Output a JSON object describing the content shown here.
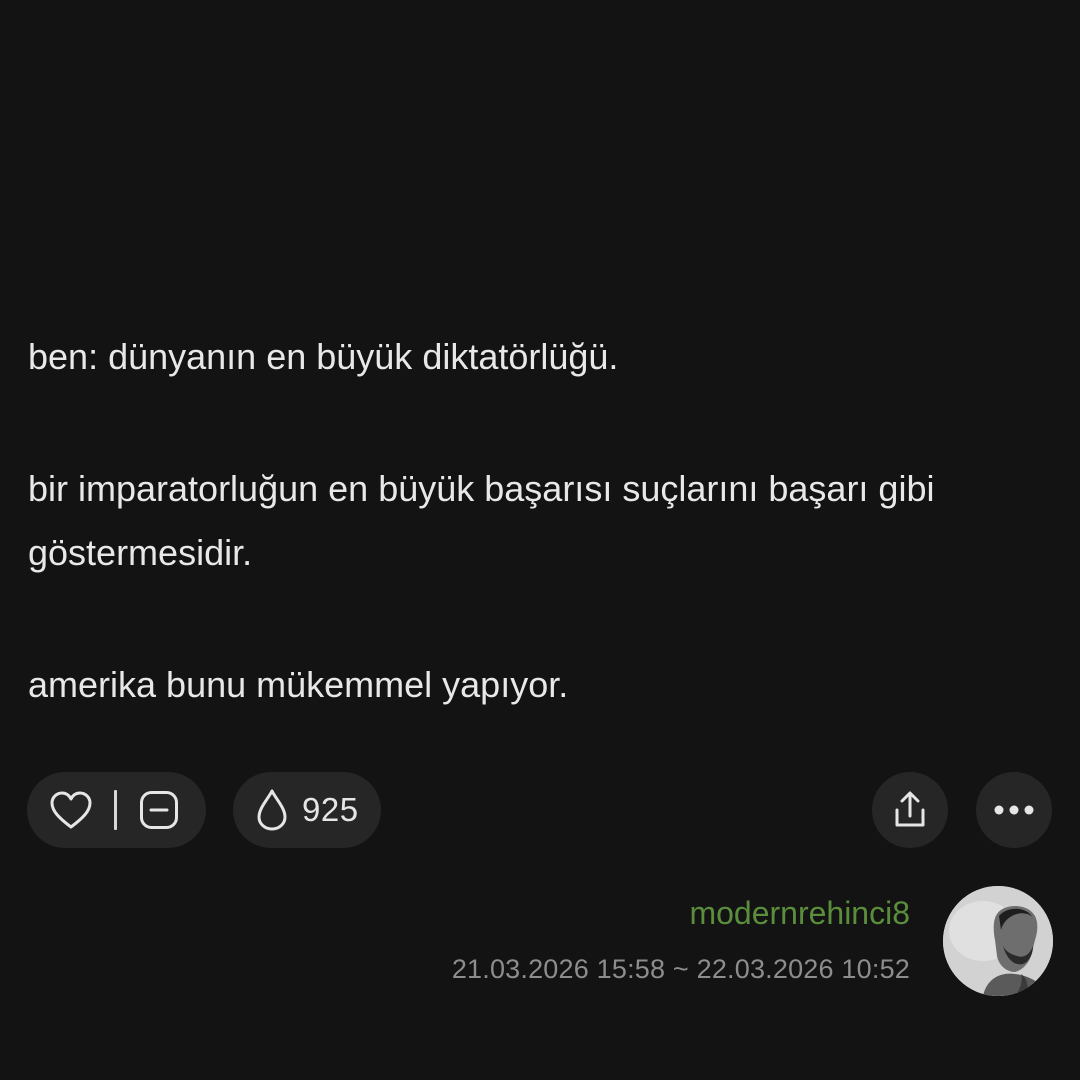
{
  "entry": {
    "paragraph_1": "ben: dünyanın en büyük diktatörlüğü.",
    "paragraph_2": "bir imparatorluğun en büyük başarısı suçlarını başarı gibi göstermesidir.",
    "paragraph_3": "amerika bunu mükemmel yapıyor."
  },
  "actions": {
    "upvote_icon": "heart-icon",
    "downvote_icon": "minus-square-icon",
    "favorite_icon": "drop-icon",
    "favorite_count": "925",
    "share_icon": "share-icon",
    "more_icon": "more-dots-icon"
  },
  "meta": {
    "author": "modernrehinci8",
    "dates": "21.03.2026 15:58 ~ 22.03.2026 10:52"
  },
  "colors": {
    "background": "#131313",
    "button_bg": "#262626",
    "author": "#5a8e3c",
    "date": "#8d8d8d",
    "text": "#e8e8e8"
  }
}
